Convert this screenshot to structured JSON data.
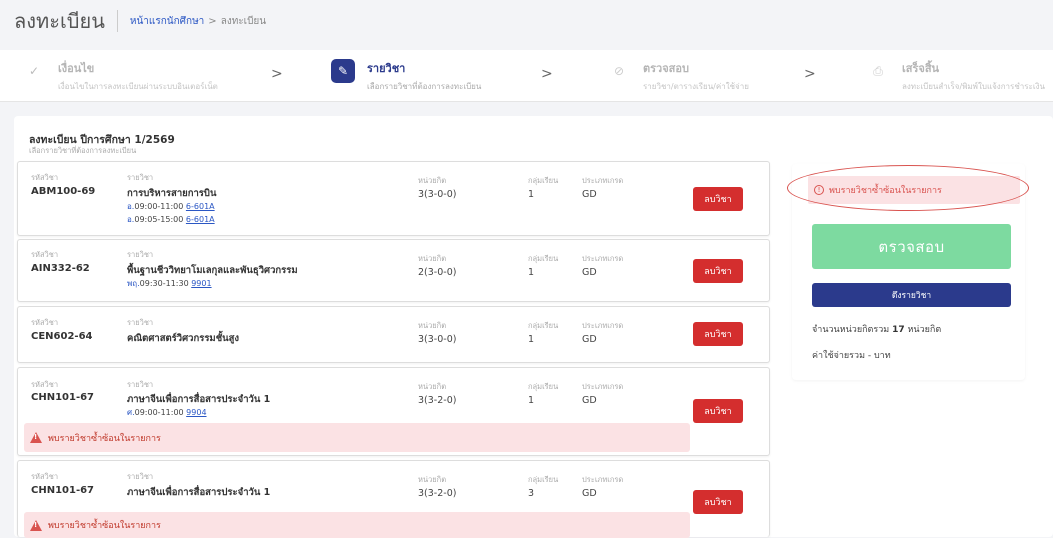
{
  "header": {
    "title": "ลงทะเบียน",
    "breadcrumb_home": "หน้าแรกนักศึกษา",
    "breadcrumb_sep": ">",
    "breadcrumb_current": "ลงทะเบียน"
  },
  "steps": [
    {
      "title": "เงื่อนไข",
      "sub": "เงื่อนไขในการลงทะเบียนผ่านระบบอินเตอร์เน็ต",
      "state": "done",
      "icon": "check-icon"
    },
    {
      "title": "รายวิชา",
      "sub": "เลือกรายวิชาที่ต้องการลงทะเบียน",
      "state": "active",
      "icon": "pencil-icon"
    },
    {
      "title": "ตรวจสอบ",
      "sub": "รายวิชา/ตารางเรียน/ค่าใช้จ่าย",
      "state": "pending",
      "icon": "check-circle-icon"
    },
    {
      "title": "เสร็จสิ้น",
      "sub": "ลงทะเบียนสำเร็จ/พิมพ์ใบแจ้งการชำระเงิน",
      "state": "pending",
      "icon": "printer-icon"
    }
  ],
  "step_arrow": ">",
  "main": {
    "title": "ลงทะเบียน ปีการศึกษา 1/2569",
    "subtitle": "เลือกรายวิชาที่ต้องการลงทะเบียน"
  },
  "labels": {
    "code": "รหัสวิชา",
    "name": "รายวิชา",
    "credit": "หน่วยกิต",
    "section": "กลุ่มเรียน",
    "type": "ประเภทเกรด",
    "delete": "ลบวิชา"
  },
  "courses": [
    {
      "code": "ABM100-69",
      "name": "การบริหารสายการบิน",
      "credit": "3(3-0-0)",
      "section": "1",
      "type": "GD",
      "times": [
        {
          "day": "อ.",
          "time": "09:00-11:00",
          "room": "6-601A"
        },
        {
          "day": "อ.",
          "time": "09:05-15:00",
          "room": "6-601A"
        }
      ],
      "warning": ""
    },
    {
      "code": "AIN332-62",
      "name": "พื้นฐานชีววิทยาโมเลกุลและพันธุวิศวกรรม",
      "credit": "2(3-0-0)",
      "section": "1",
      "type": "GD",
      "times": [
        {
          "day": "พฤ.",
          "time": "09:30-11:30",
          "room": "9901"
        }
      ],
      "warning": ""
    },
    {
      "code": "CEN602-64",
      "name": "คณิตศาสตร์วิศวกรรมชั้นสูง",
      "credit": "3(3-0-0)",
      "section": "1",
      "type": "GD",
      "times": [],
      "warning": ""
    },
    {
      "code": "CHN101-67",
      "name": "ภาษาจีนเพื่อการสื่อสารประจำวัน 1",
      "credit": "3(3-2-0)",
      "section": "1",
      "type": "GD",
      "times": [
        {
          "day": "ศ.",
          "time": "09:00-11:00",
          "room": "9904"
        }
      ],
      "warning": "พบรายวิชาซ้ำซ้อนในรายการ"
    },
    {
      "code": "CHN101-67",
      "name": "ภาษาจีนเพื่อการสื่อสารประจำวัน 1",
      "credit": "3(3-2-0)",
      "section": "3",
      "type": "GD",
      "times": [],
      "warning": "พบรายวิชาซ้ำซ้อนในรายการ"
    }
  ],
  "side": {
    "alert": "พบรายวิชาซ้ำซ้อนในรายการ",
    "check_label": "ตรวจสอบ",
    "pull_label": "ดึงรายวิชา",
    "total_units_pre": "จำนวนหน่วยกิตรวม",
    "total_units_value": "17",
    "total_units_post": "หน่วยกิต",
    "total_cost": "ค่าใช้จ่ายรวม - บาท"
  },
  "colors": {
    "primary": "#2b3a8c",
    "danger": "#d42e2e",
    "success": "#7ddaa0",
    "warn_bg": "#fbe2e4"
  }
}
